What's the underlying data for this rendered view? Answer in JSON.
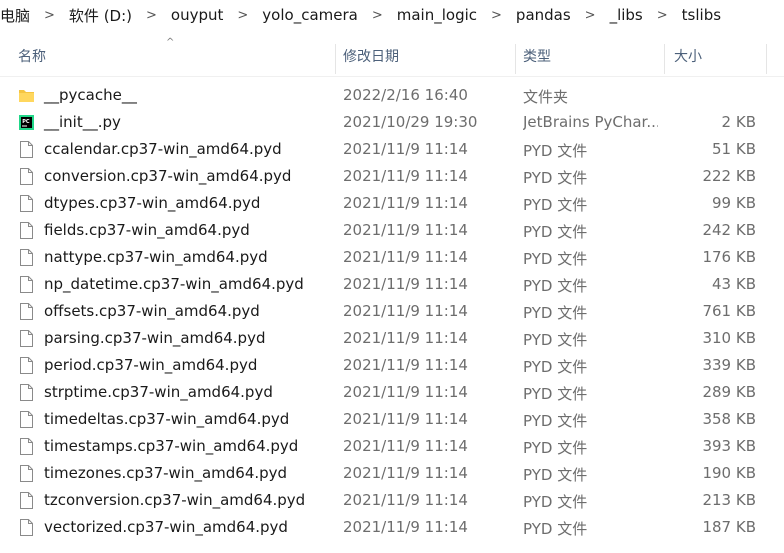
{
  "breadcrumb": [
    "电脑",
    "软件 (D:)",
    "ouyput",
    "yolo_camera",
    "main_logic",
    "pandas",
    "_libs",
    "tslibs"
  ],
  "columns": {
    "name": "名称",
    "date": "修改日期",
    "type": "类型",
    "size": "大小"
  },
  "files": [
    {
      "icon": "folder-icon",
      "name": "__pycache__",
      "date": "2022/2/16 16:40",
      "type": "文件夹",
      "size": ""
    },
    {
      "icon": "pycharm-file-icon",
      "name": "__init__.py",
      "date": "2021/10/29 19:30",
      "type": "JetBrains PyChar...",
      "size": "2 KB"
    },
    {
      "icon": "file-icon",
      "name": "ccalendar.cp37-win_amd64.pyd",
      "date": "2021/11/9 11:14",
      "type": "PYD 文件",
      "size": "51 KB"
    },
    {
      "icon": "file-icon",
      "name": "conversion.cp37-win_amd64.pyd",
      "date": "2021/11/9 11:14",
      "type": "PYD 文件",
      "size": "222 KB"
    },
    {
      "icon": "file-icon",
      "name": "dtypes.cp37-win_amd64.pyd",
      "date": "2021/11/9 11:14",
      "type": "PYD 文件",
      "size": "99 KB"
    },
    {
      "icon": "file-icon",
      "name": "fields.cp37-win_amd64.pyd",
      "date": "2021/11/9 11:14",
      "type": "PYD 文件",
      "size": "242 KB"
    },
    {
      "icon": "file-icon",
      "name": "nattype.cp37-win_amd64.pyd",
      "date": "2021/11/9 11:14",
      "type": "PYD 文件",
      "size": "176 KB"
    },
    {
      "icon": "file-icon",
      "name": "np_datetime.cp37-win_amd64.pyd",
      "date": "2021/11/9 11:14",
      "type": "PYD 文件",
      "size": "43 KB"
    },
    {
      "icon": "file-icon",
      "name": "offsets.cp37-win_amd64.pyd",
      "date": "2021/11/9 11:14",
      "type": "PYD 文件",
      "size": "761 KB"
    },
    {
      "icon": "file-icon",
      "name": "parsing.cp37-win_amd64.pyd",
      "date": "2021/11/9 11:14",
      "type": "PYD 文件",
      "size": "310 KB"
    },
    {
      "icon": "file-icon",
      "name": "period.cp37-win_amd64.pyd",
      "date": "2021/11/9 11:14",
      "type": "PYD 文件",
      "size": "339 KB"
    },
    {
      "icon": "file-icon",
      "name": "strptime.cp37-win_amd64.pyd",
      "date": "2021/11/9 11:14",
      "type": "PYD 文件",
      "size": "289 KB"
    },
    {
      "icon": "file-icon",
      "name": "timedeltas.cp37-win_amd64.pyd",
      "date": "2021/11/9 11:14",
      "type": "PYD 文件",
      "size": "358 KB"
    },
    {
      "icon": "file-icon",
      "name": "timestamps.cp37-win_amd64.pyd",
      "date": "2021/11/9 11:14",
      "type": "PYD 文件",
      "size": "393 KB"
    },
    {
      "icon": "file-icon",
      "name": "timezones.cp37-win_amd64.pyd",
      "date": "2021/11/9 11:14",
      "type": "PYD 文件",
      "size": "190 KB"
    },
    {
      "icon": "file-icon",
      "name": "tzconversion.cp37-win_amd64.pyd",
      "date": "2021/11/9 11:14",
      "type": "PYD 文件",
      "size": "213 KB"
    },
    {
      "icon": "file-icon",
      "name": "vectorized.cp37-win_amd64.pyd",
      "date": "2021/11/9 11:14",
      "type": "PYD 文件",
      "size": "187 KB"
    }
  ]
}
